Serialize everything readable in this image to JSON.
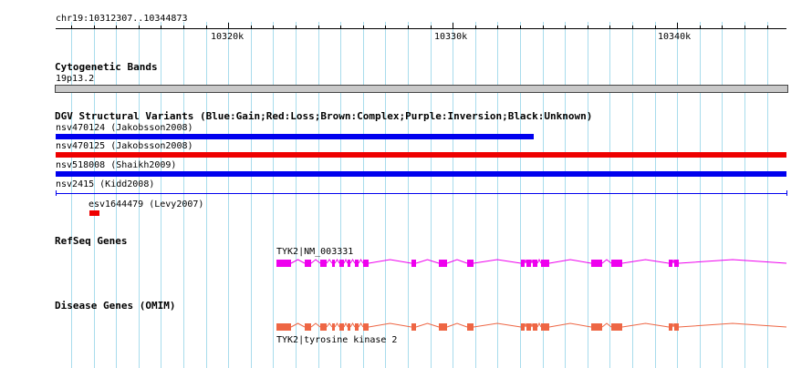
{
  "ruler": {
    "location": "chr19:10312307..10344873",
    "start": 10312307,
    "end": 10344873,
    "labels": [
      "10320k",
      "10330k",
      "10340k"
    ],
    "label_positions": [
      10320000,
      10330000,
      10340000
    ]
  },
  "tracks": {
    "cytobands": {
      "title": "Cytogenetic Bands",
      "band": "19p13.2"
    },
    "dgv": {
      "title": "DGV Structural Variants (Blue:Gain;Red:Loss;Brown:Complex;Purple:Inversion;Black:Unknown)",
      "features": [
        {
          "label": "nsv470124 (Jakobsson2008)",
          "type": "gain",
          "color": "#0000ee",
          "start": 10312307,
          "end": 10333600
        },
        {
          "label": "nsv470125 (Jakobsson2008)",
          "type": "loss",
          "color": "#ee0000",
          "start": 10312307,
          "end": 10344873
        },
        {
          "label": "nsv518008 (Shaikh2009)",
          "type": "gain",
          "color": "#0000ee",
          "start": 10312307,
          "end": 10344873
        },
        {
          "label": "nsv2415 (Kidd2008)",
          "type": "unknown-line",
          "color": "#0000ee",
          "start": 10312307,
          "end": 10344873
        },
        {
          "label": "esv1644479 (Levy2007)",
          "type": "loss",
          "color": "#ee0000",
          "start": 10313800,
          "end": 10314250
        }
      ]
    },
    "refseq": {
      "title": "RefSeq Genes",
      "gene_label": "TYK2|NM_003331",
      "color": "#ee00ee"
    },
    "omim": {
      "title": "Disease Genes (OMIM)",
      "gene_label": "TYK2|tyrosine kinase 2",
      "color": "#ee6644"
    }
  }
}
